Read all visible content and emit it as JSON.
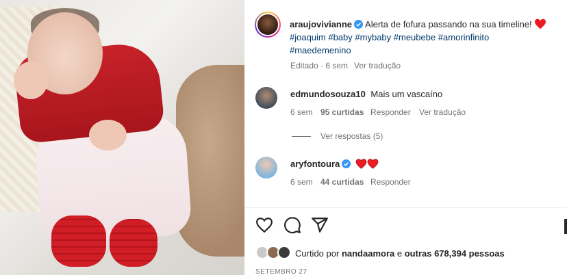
{
  "post": {
    "author": "araujovivianne",
    "caption": "Alerta de fofura passando na sua timeline!",
    "hashtags_line1": "#joaquim #baby #mybaby #meubebe #amorinfinito",
    "hashtags_line2": "#maedemenino",
    "edited": "Editado · 6 sem",
    "see_translation": "Ver tradução"
  },
  "comments": [
    {
      "username": "edmundosouza10",
      "text": "Mais um vascaíno",
      "age": "6 sem",
      "likes": "95 curtidas",
      "reply": "Responder",
      "translate": "Ver tradução",
      "replies": "Ver respostas (5)"
    },
    {
      "username": "aryfontoura",
      "age": "6 sem",
      "likes": "44 curtidas",
      "reply": "Responder"
    }
  ],
  "likes": {
    "prefix": "Curtido por",
    "user": "nandaamora",
    "conjunction": "e",
    "others": "outras 678,394 pessoas"
  },
  "date": "SETEMBRO 27",
  "colors": {
    "heart": "#ed1c24",
    "verified": "#3897f0",
    "hashtag": "#00376b",
    "muted": "#737373"
  },
  "icons": [
    "heart-outline-icon",
    "comment-icon",
    "share-icon",
    "verified-icon",
    "heart-icon"
  ]
}
